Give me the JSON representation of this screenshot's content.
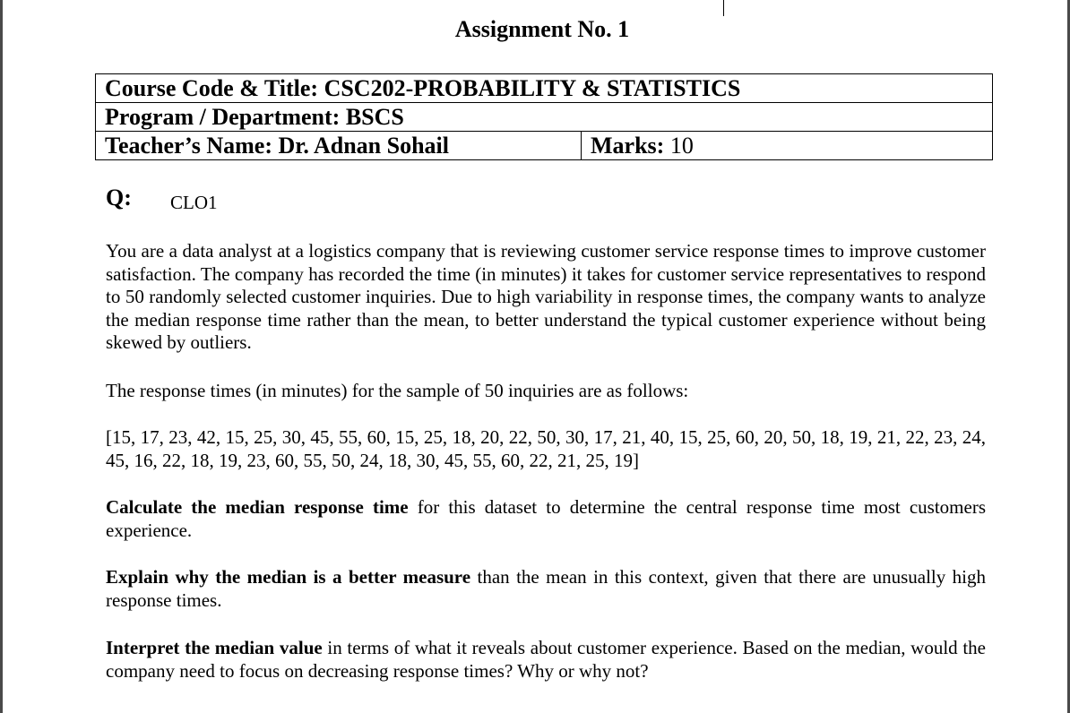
{
  "title": "Assignment No. 1",
  "course": {
    "course_label": "Course Code & Title: CSC202-PROBABILITY & STATISTICS",
    "program_label": "Program / Department: BSCS",
    "teacher_label": "Teacher’s Name: Dr. Adnan Sohail",
    "marks_label": "Marks:",
    "marks_value": "10"
  },
  "question": {
    "label": "Q:",
    "clo": "CLO1",
    "intro": "You are a data analyst at a logistics company that is reviewing customer service response times to improve customer satisfaction. The company has recorded the time (in minutes) it takes for customer service representatives to respond to 50 randomly selected customer inquiries. Due to high variability in response times, the company wants to analyze the median response time rather than the mean, to better understand the typical customer experience without being skewed by outliers.",
    "sample_intro": "The response times (in minutes) for the sample of 50 inquiries are as follows:",
    "data": "[15, 17, 23, 42, 15, 25, 30, 45, 55, 60, 15, 25, 18, 20, 22, 50, 30, 17, 21, 40, 15, 25, 60, 20, 50, 18, 19, 21, 22, 23, 24, 45, 16, 22, 18, 19, 23, 60, 55, 50, 24, 18, 30, 45, 55, 60, 22, 21, 25, 19]",
    "tasks": [
      {
        "bold": "Calculate the median response time",
        "rest": " for this dataset to determine the central response time most customers experience."
      },
      {
        "bold": "Explain why the median is a better measure",
        "rest": " than the mean in this context, given that there are unusually high response times."
      },
      {
        "bold": "Interpret the median value",
        "rest": " in terms of what it reveals about customer experience. Based on the median, would the company need to focus on decreasing response times? Why or why not?"
      }
    ]
  }
}
